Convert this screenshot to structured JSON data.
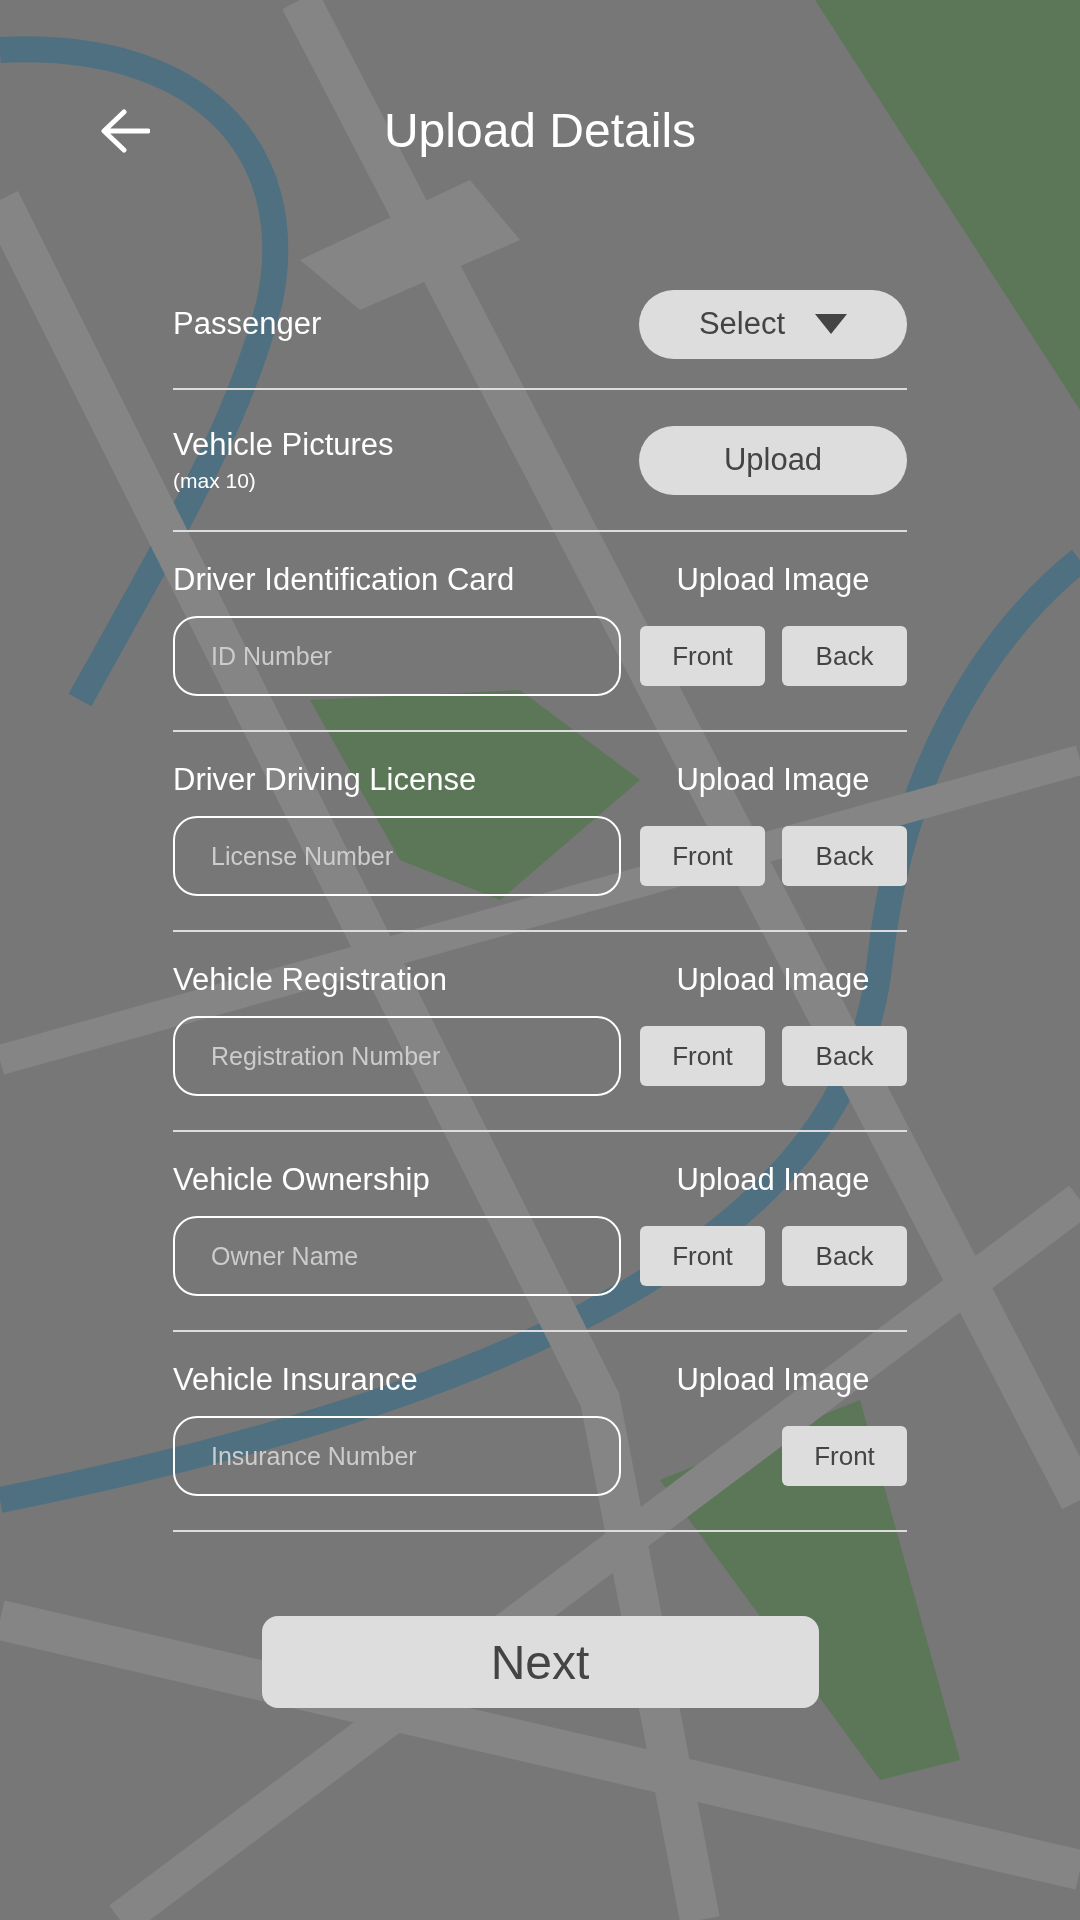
{
  "header": {
    "title": "Upload Details"
  },
  "passenger": {
    "label": "Passenger",
    "select": "Select"
  },
  "vehicle_pictures": {
    "label": "Vehicle Pictures",
    "note": "(max 10)",
    "button": "Upload"
  },
  "documents": [
    {
      "label": "Driver Identification Card",
      "upload_label": "Upload Image",
      "placeholder": "ID Number",
      "buttons": [
        "Front",
        "Back"
      ]
    },
    {
      "label": "Driver Driving License",
      "upload_label": "Upload Image",
      "placeholder": "License Number",
      "buttons": [
        "Front",
        "Back"
      ]
    },
    {
      "label": "Vehicle Registration",
      "upload_label": "Upload Image",
      "placeholder": "Registration Number",
      "buttons": [
        "Front",
        "Back"
      ]
    },
    {
      "label": "Vehicle Ownership",
      "upload_label": "Upload Image",
      "placeholder": "Owner Name",
      "buttons": [
        "Front",
        "Back"
      ]
    },
    {
      "label": "Vehicle Insurance",
      "upload_label": "Upload Image",
      "placeholder": "Insurance Number",
      "buttons": [
        "Front"
      ]
    }
  ],
  "next_button": "Next"
}
